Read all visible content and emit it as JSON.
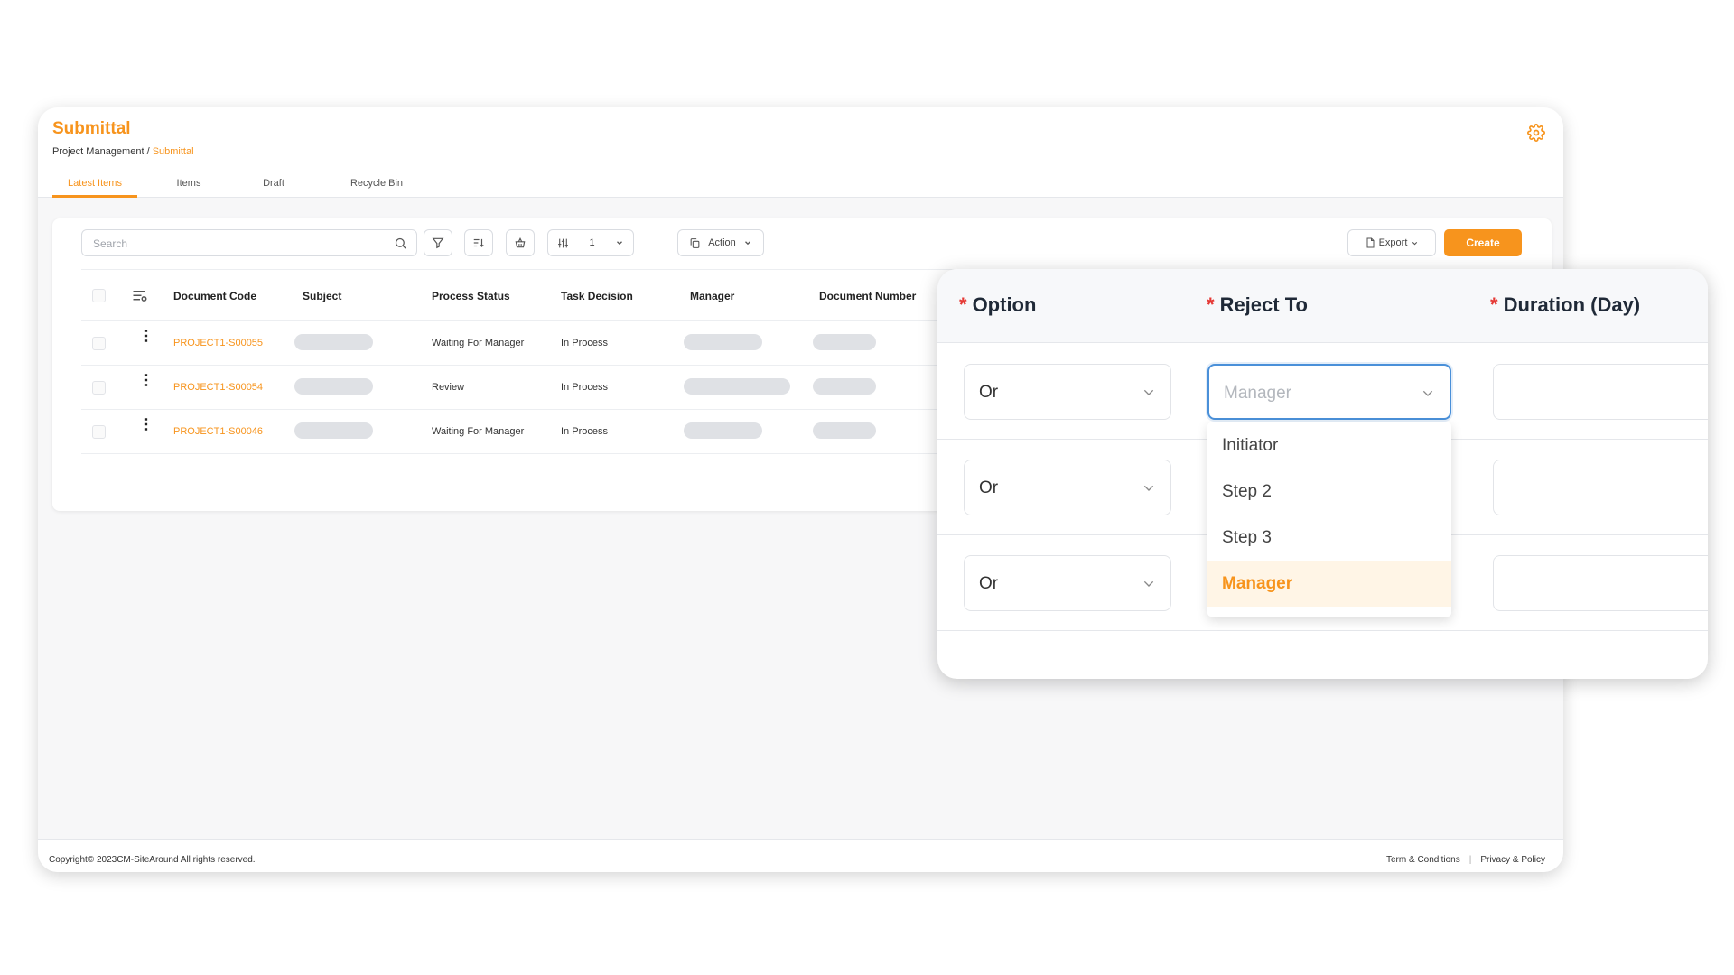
{
  "header": {
    "title": "Submittal",
    "breadcrumb": {
      "parent": "Project Management",
      "separator": "/",
      "current": "Submittal"
    },
    "settings_icon": "gear-icon"
  },
  "tabs": [
    {
      "label": "Latest Items",
      "active": true
    },
    {
      "label": "Items",
      "active": false
    },
    {
      "label": "Draft",
      "active": false
    },
    {
      "label": "Recycle Bin",
      "active": false
    }
  ],
  "toolbar": {
    "search_placeholder": "Search",
    "page_size": "1",
    "action_label": "Action",
    "export_label": "Export",
    "create_label": "Create"
  },
  "table": {
    "columns": [
      "Document Code",
      "Subject",
      "Process Status",
      "Task Decision",
      "Manager",
      "Document Number"
    ],
    "rows": [
      {
        "code": "PROJECT1-S00055",
        "status": "Waiting For Manager",
        "decision": "In Process"
      },
      {
        "code": "PROJECT1-S00054",
        "status": "Review",
        "decision": "In Process"
      },
      {
        "code": "PROJECT1-S00046",
        "status": "Waiting For Manager",
        "decision": "In Process"
      }
    ]
  },
  "footer": {
    "copyright": "Copyright© 2023CM-SiteAround All rights reserved.",
    "terms": "Term & Conditions",
    "separator": "|",
    "privacy": "Privacy & Policy"
  },
  "panel": {
    "required_mark": "*",
    "columns": {
      "option": "Option",
      "reject_to": "Reject To",
      "duration": "Duration (Day)"
    },
    "rows": [
      {
        "option": "Or",
        "reject_to": "Manager"
      },
      {
        "option": "Or",
        "reject_to": ""
      },
      {
        "option": "Or",
        "reject_to": ""
      }
    ],
    "dropdown_options": [
      "Initiator",
      "Step 2",
      "Step 3",
      "Manager"
    ],
    "selected_option": "Manager"
  },
  "colors": {
    "accent": "#f7941d",
    "focus": "#4a90d9",
    "required": "#e53935"
  }
}
